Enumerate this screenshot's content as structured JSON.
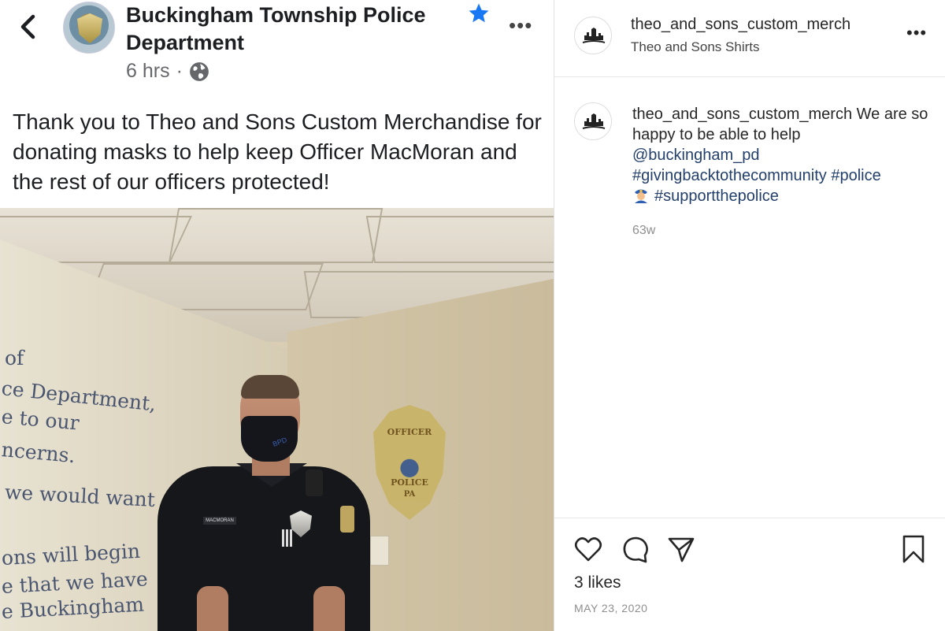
{
  "facebook_post": {
    "page_name": "Buckingham Township Police Department",
    "time": "6 hrs",
    "separator": "·",
    "more": "•••",
    "body": "Thank you to Theo and Sons Custom Merchandise for donating masks to help keep Officer MacMoran and the rest of our officers protected!",
    "accent_color": "#1877f2",
    "photo": {
      "wall_lines": [
        "of",
        "ce Department,",
        "e to our",
        "ncerns.",
        "we would want",
        "ons will begin",
        "e that we have",
        "e Buckingham"
      ],
      "badge_lines": [
        "OFFICER",
        "POLICE",
        "PA"
      ],
      "nametag": "MACMORAN",
      "mask_text": "BPD"
    }
  },
  "instagram_post": {
    "header": {
      "username": "theo_and_sons_custom_merch",
      "subtitle": "Theo and Sons Shirts",
      "more": "•••"
    },
    "caption": {
      "username": "theo_and_sons_custom_merch",
      "text": "We are so happy to be able to help",
      "mention": "@buckingham_pd",
      "tag1": "#givingbacktothecommunity",
      "tag2": "#police",
      "tag3": "#supportthepolice",
      "time": "63w"
    },
    "likes": "3 likes",
    "date": "MAY 23, 2020",
    "link_color": "#233f6b"
  }
}
